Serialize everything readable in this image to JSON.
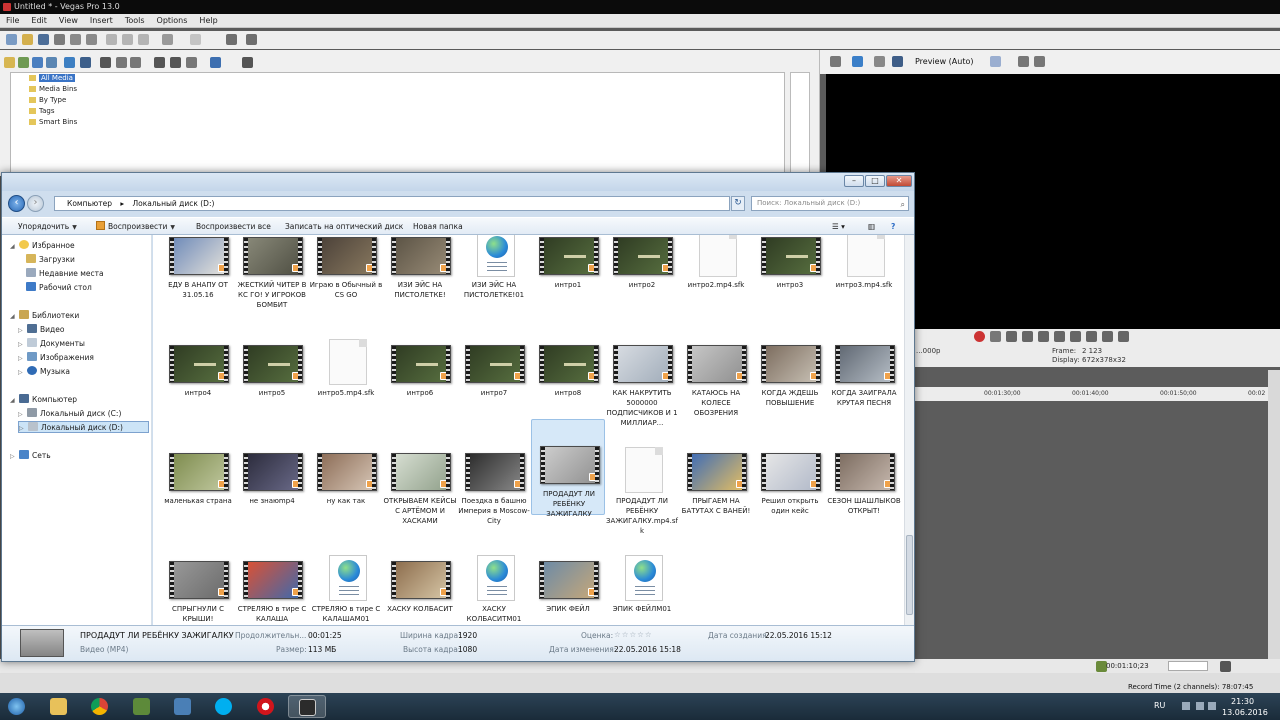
{
  "vegas": {
    "title": "Untitled * - Vegas Pro 13.0",
    "menu": [
      "File",
      "Edit",
      "View",
      "Insert",
      "Tools",
      "Options",
      "Help"
    ],
    "media_tree": [
      "All Media",
      "Media Bins",
      "By Type",
      "Tags",
      "Smart Bins"
    ],
    "preview": {
      "mode": "Preview (Auto)",
      "project_label": "...000p",
      "frame_label": "Frame:",
      "frame_value": "2 123",
      "display_label": "Display:",
      "display_value": "672x378x32"
    },
    "ruler": [
      "00:01:30;00",
      "00:01:40;00",
      "00:01:50;00",
      "00:02"
    ],
    "timecode": "00:01:10;23",
    "record_time": "Record Time (2 channels): 78:07:45"
  },
  "dialog": {
    "address": [
      "Компьютер",
      "Локальный диск (D:)"
    ],
    "search_placeholder": "Поиск: Локальный диск (D:)",
    "commands": [
      "Упорядочить",
      "Воспроизвести",
      "Воспроизвести все",
      "Записать на оптический диск",
      "Новая папка"
    ],
    "nav": {
      "favorites": "Избранное",
      "favorites_items": [
        "Загрузки",
        "Недавние места",
        "Рабочий стол"
      ],
      "libraries": "Библиотеки",
      "libraries_items": [
        "Видео",
        "Документы",
        "Изображения",
        "Музыка"
      ],
      "computer": "Компьютер",
      "computer_items": [
        "Локальный диск (C:)",
        "Локальный диск (D:)"
      ],
      "network": "Сеть"
    },
    "files": [
      {
        "name": "ЕДУ В АНАПУ ОТ 31.05.16",
        "kind": "video"
      },
      {
        "name": "ЖЕСТКИЙ ЧИТЕР В КС ГО! У ИГРОКОВ БОМБИТ",
        "kind": "video"
      },
      {
        "name": "Играю в Обычный в CS GO",
        "kind": "video"
      },
      {
        "name": "ИЗИ ЭЙС НА ПИСТОЛЕТКЕ!",
        "kind": "video"
      },
      {
        "name": "ИЗИ ЭЙС НА ПИСТОЛЕТКЕ!01",
        "kind": "sfk"
      },
      {
        "name": "интро1",
        "kind": "video"
      },
      {
        "name": "интро2",
        "kind": "video"
      },
      {
        "name": "интро2.mp4.sfk",
        "kind": "doc"
      },
      {
        "name": "интро3",
        "kind": "video"
      },
      {
        "name": "интро3.mp4.sfk",
        "kind": "doc"
      },
      {
        "name": "интро4",
        "kind": "video"
      },
      {
        "name": "интро5",
        "kind": "video"
      },
      {
        "name": "интро5.mp4.sfk",
        "kind": "doc"
      },
      {
        "name": "интро6",
        "kind": "video"
      },
      {
        "name": "интро7",
        "kind": "video"
      },
      {
        "name": "интро8",
        "kind": "video"
      },
      {
        "name": "КАК НАКРУТИТЬ 5000000 ПОДПИСЧИКОВ И 1 МИЛЛИАР...",
        "kind": "video"
      },
      {
        "name": "КАТАЮСЬ НА КОЛЕСЕ ОБОЗРЕНИЯ",
        "kind": "video"
      },
      {
        "name": "КОГДА ЖДЕШЬ ПОВЫШЕНИЕ",
        "kind": "video"
      },
      {
        "name": "КОГДА ЗАИГРАЛА КРУТАЯ ПЕСНЯ",
        "kind": "video"
      },
      {
        "name": "маленькая страна",
        "kind": "video"
      },
      {
        "name": "не знаюmp4",
        "kind": "video"
      },
      {
        "name": "ну как так",
        "kind": "video"
      },
      {
        "name": "ОТКРЫВАЕМ КЕЙСЫ С АРТЁМОМ И ХАСКАМИ",
        "kind": "video"
      },
      {
        "name": "Поездка в башню Империя в Moscow-City",
        "kind": "video"
      },
      {
        "name": "ПРОДАДУТ ЛИ РЕБЁНКУ ЗАЖИГАЛКУ",
        "kind": "video"
      },
      {
        "name": "ПРОДАДУТ ЛИ РЕБЁНКУ ЗАЖИГАЛКУ.mp4.sfk",
        "kind": "doc"
      },
      {
        "name": "ПРЫГАЕМ НА БАТУТАХ С ВАНЕЙ!",
        "kind": "video"
      },
      {
        "name": "Решил открыть один кейс",
        "kind": "video"
      },
      {
        "name": "СЕЗОН ШАШЛЫКОВ ОТКРЫТ!",
        "kind": "video"
      },
      {
        "name": "СПРЫГНУЛИ С КРЫШИ!",
        "kind": "video"
      },
      {
        "name": "СТРЕЛЯЮ в тире С КАЛАША",
        "kind": "video"
      },
      {
        "name": "СТРЕЛЯЮ в тире С КАЛАШАМ01",
        "kind": "sfk"
      },
      {
        "name": "ХАСКУ КОЛБАСИТ",
        "kind": "video"
      },
      {
        "name": "ХАСКУ КОЛБАСИТМ01",
        "kind": "sfk"
      },
      {
        "name": "ЭПИК ФЕЙЛ",
        "kind": "video"
      },
      {
        "name": "ЭПИК ФЕЙЛМ01",
        "kind": "sfk"
      }
    ],
    "details": {
      "name": "ПРОДАДУТ ЛИ РЕБЁНКУ ЗАЖИГАЛКУ",
      "type": "Видео (MP4)",
      "duration_label": "Продолжительн...",
      "duration_value": "00:01:25",
      "size_label": "Размер:",
      "size_value": "113 МБ",
      "width_label": "Ширина кадра:",
      "width_value": "1920",
      "height_label": "Высота кадра:",
      "height_value": "1080",
      "rating_label": "Оценка:",
      "rating_value": "☆☆☆☆☆",
      "modified_label": "Дата изменения:",
      "modified_value": "22.05.2016 15:18",
      "created_label": "Дата создания:",
      "created_value": "22.05.2016 15:12"
    }
  },
  "taskbar": {
    "lang": "RU",
    "time": "21:30",
    "date": "13.06.2016"
  }
}
